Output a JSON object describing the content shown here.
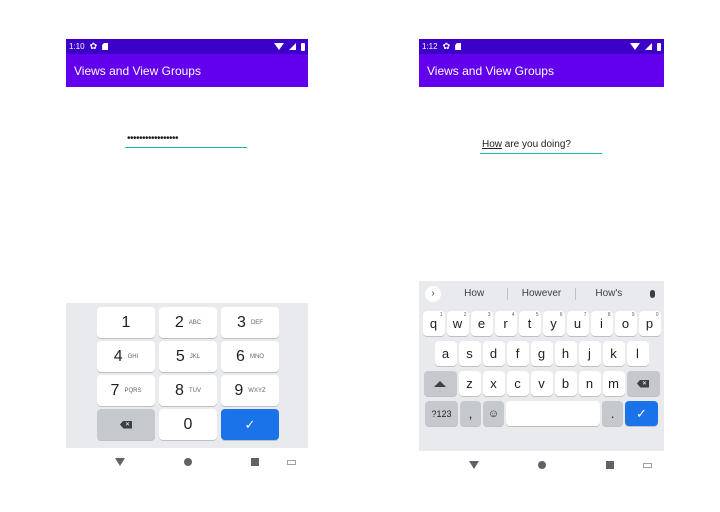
{
  "left_phone": {
    "status": {
      "time": "1:10"
    },
    "app_title": "Views and View Groups",
    "field_value": "•••••••••••••••••",
    "numpad": {
      "keys": [
        {
          "digit": "1",
          "sub": ""
        },
        {
          "digit": "2",
          "sub": "ABC"
        },
        {
          "digit": "3",
          "sub": "DEF"
        },
        {
          "digit": "4",
          "sub": "GHI"
        },
        {
          "digit": "5",
          "sub": "JKL"
        },
        {
          "digit": "6",
          "sub": "MNO"
        },
        {
          "digit": "7",
          "sub": "PQRS"
        },
        {
          "digit": "8",
          "sub": "TUV"
        },
        {
          "digit": "9",
          "sub": "WXYZ"
        }
      ],
      "zero": "0",
      "done_glyph": "✓",
      "backspace_glyph": "✕"
    }
  },
  "right_phone": {
    "status": {
      "time": "1:12"
    },
    "app_title": "Views and View Groups",
    "field_word": "How",
    "field_rest": " are you doing?",
    "suggestions": [
      "How",
      "However",
      "How's"
    ],
    "chevron_glyph": "›",
    "rows": [
      [
        {
          "k": "q",
          "h": "1"
        },
        {
          "k": "w",
          "h": "2"
        },
        {
          "k": "e",
          "h": "3"
        },
        {
          "k": "r",
          "h": "4"
        },
        {
          "k": "t",
          "h": "5"
        },
        {
          "k": "y",
          "h": "6"
        },
        {
          "k": "u",
          "h": "7"
        },
        {
          "k": "i",
          "h": "8"
        },
        {
          "k": "o",
          "h": "9"
        },
        {
          "k": "p",
          "h": "0"
        }
      ],
      [
        "a",
        "s",
        "d",
        "f",
        "g",
        "h",
        "j",
        "k",
        "l"
      ],
      [
        "z",
        "x",
        "c",
        "v",
        "b",
        "n",
        "m"
      ]
    ],
    "sym_label": "?123",
    "comma_label": ",",
    "emoji_glyph": "☺",
    "period_label": ".",
    "done_glyph": "✓",
    "backspace_glyph": "✕"
  },
  "colors": {
    "status_bar": "#3d00c8",
    "app_bar": "#6200ee",
    "accent_underline": "#16b8a6",
    "action_key": "#1a73e8"
  },
  "icons": [
    "gear-icon",
    "sd-card-icon",
    "wifi-icon",
    "signal-icon",
    "battery-icon",
    "backspace-icon",
    "check-icon",
    "microphone-icon",
    "emoji-icon",
    "shift-icon",
    "back-icon",
    "home-icon",
    "recents-icon",
    "keyboard-switch-icon"
  ]
}
